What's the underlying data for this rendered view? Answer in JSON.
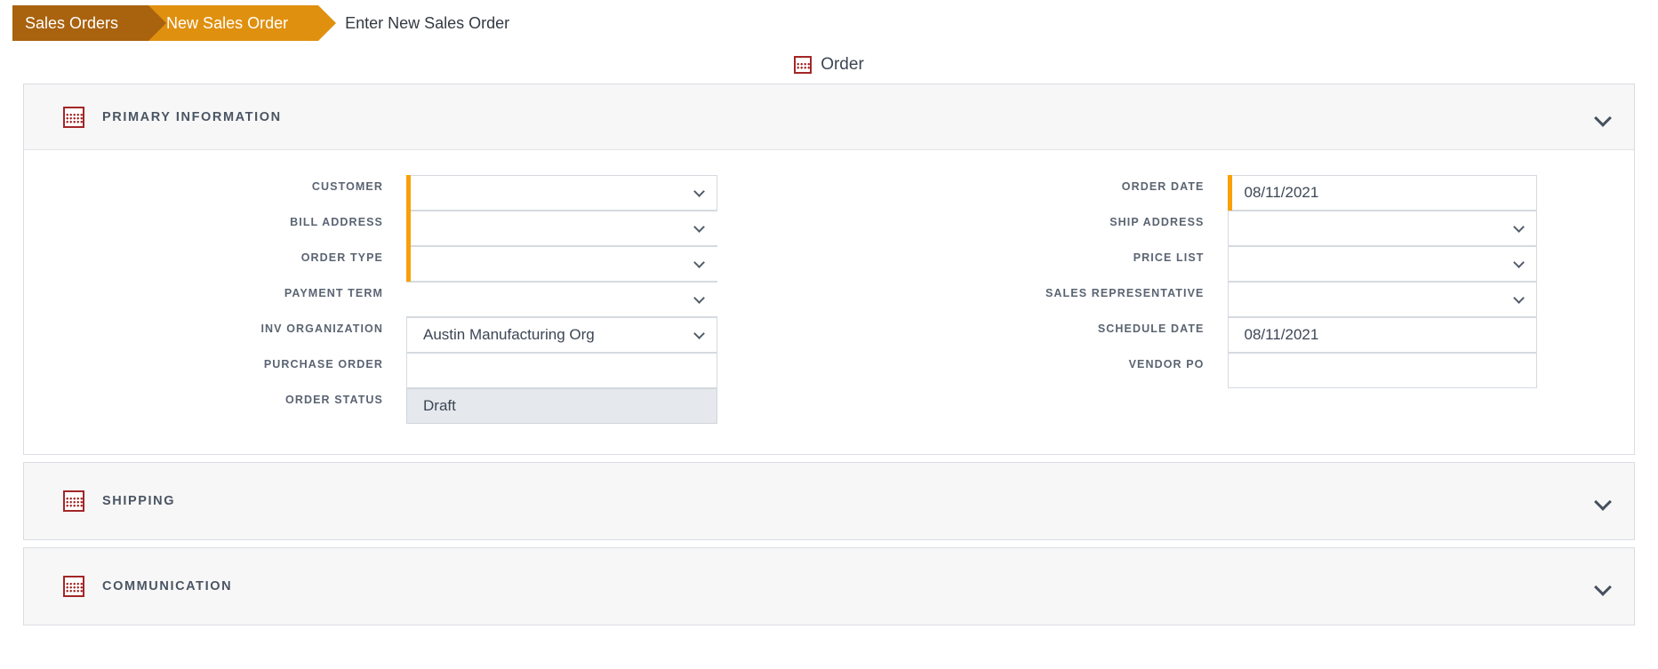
{
  "breadcrumb": {
    "items": [
      {
        "label": "Sales Orders"
      },
      {
        "label": "New Sales Order"
      }
    ],
    "current": "Enter New Sales Order"
  },
  "tab": {
    "label": "Order",
    "icon": "grid-icon"
  },
  "sections": [
    {
      "id": "primary-information",
      "title": "PRIMARY INFORMATION",
      "icon": "grid-icon",
      "collapse_icon": "chevron-down-icon",
      "expanded": true
    },
    {
      "id": "shipping",
      "title": "SHIPPING",
      "icon": "grid-icon",
      "collapse_icon": "chevron-down-icon",
      "expanded": false
    },
    {
      "id": "communication",
      "title": "COMMUNICATION",
      "icon": "grid-icon",
      "collapse_icon": "chevron-down-icon",
      "expanded": false
    }
  ],
  "form": {
    "left": [
      {
        "label": "CUSTOMER",
        "value": "",
        "type": "select",
        "required": true,
        "disabled": false
      },
      {
        "label": "BILL ADDRESS",
        "value": "",
        "type": "select",
        "required": true,
        "disabled": false
      },
      {
        "label": "ORDER TYPE",
        "value": "",
        "type": "select",
        "required": true,
        "disabled": false
      },
      {
        "label": "PAYMENT TERM",
        "value": "",
        "type": "select",
        "required": false,
        "disabled": false
      },
      {
        "label": "INV ORGANIZATION",
        "value": "Austin Manufacturing Org",
        "type": "select",
        "required": false,
        "disabled": false
      },
      {
        "label": "PURCHASE ORDER",
        "value": "",
        "type": "text",
        "required": false,
        "disabled": false
      },
      {
        "label": "ORDER STATUS",
        "value": "Draft",
        "type": "text",
        "required": false,
        "disabled": true
      }
    ],
    "right": [
      {
        "label": "ORDER DATE",
        "value": "08/11/2021",
        "type": "text",
        "required": true,
        "disabled": false
      },
      {
        "label": "SHIP ADDRESS",
        "value": "",
        "type": "select",
        "required": false,
        "disabled": false
      },
      {
        "label": "PRICE LIST",
        "value": "",
        "type": "select",
        "required": false,
        "disabled": false
      },
      {
        "label": "SALES REPRESENTATIVE",
        "value": "",
        "type": "select",
        "required": false,
        "disabled": false
      },
      {
        "label": "SCHEDULE DATE",
        "value": "08/11/2021",
        "type": "text",
        "required": false,
        "disabled": false
      },
      {
        "label": "VENDOR PO",
        "value": "",
        "type": "text",
        "required": false,
        "disabled": false
      }
    ]
  },
  "colors": {
    "breadcrumb_past": "#a9620e",
    "breadcrumb_current": "#e0900f",
    "required_marker": "#f8a009",
    "icon_red": "#a32626",
    "label_text": "#5a6472",
    "panel_header_bg": "#f7f7f7"
  }
}
